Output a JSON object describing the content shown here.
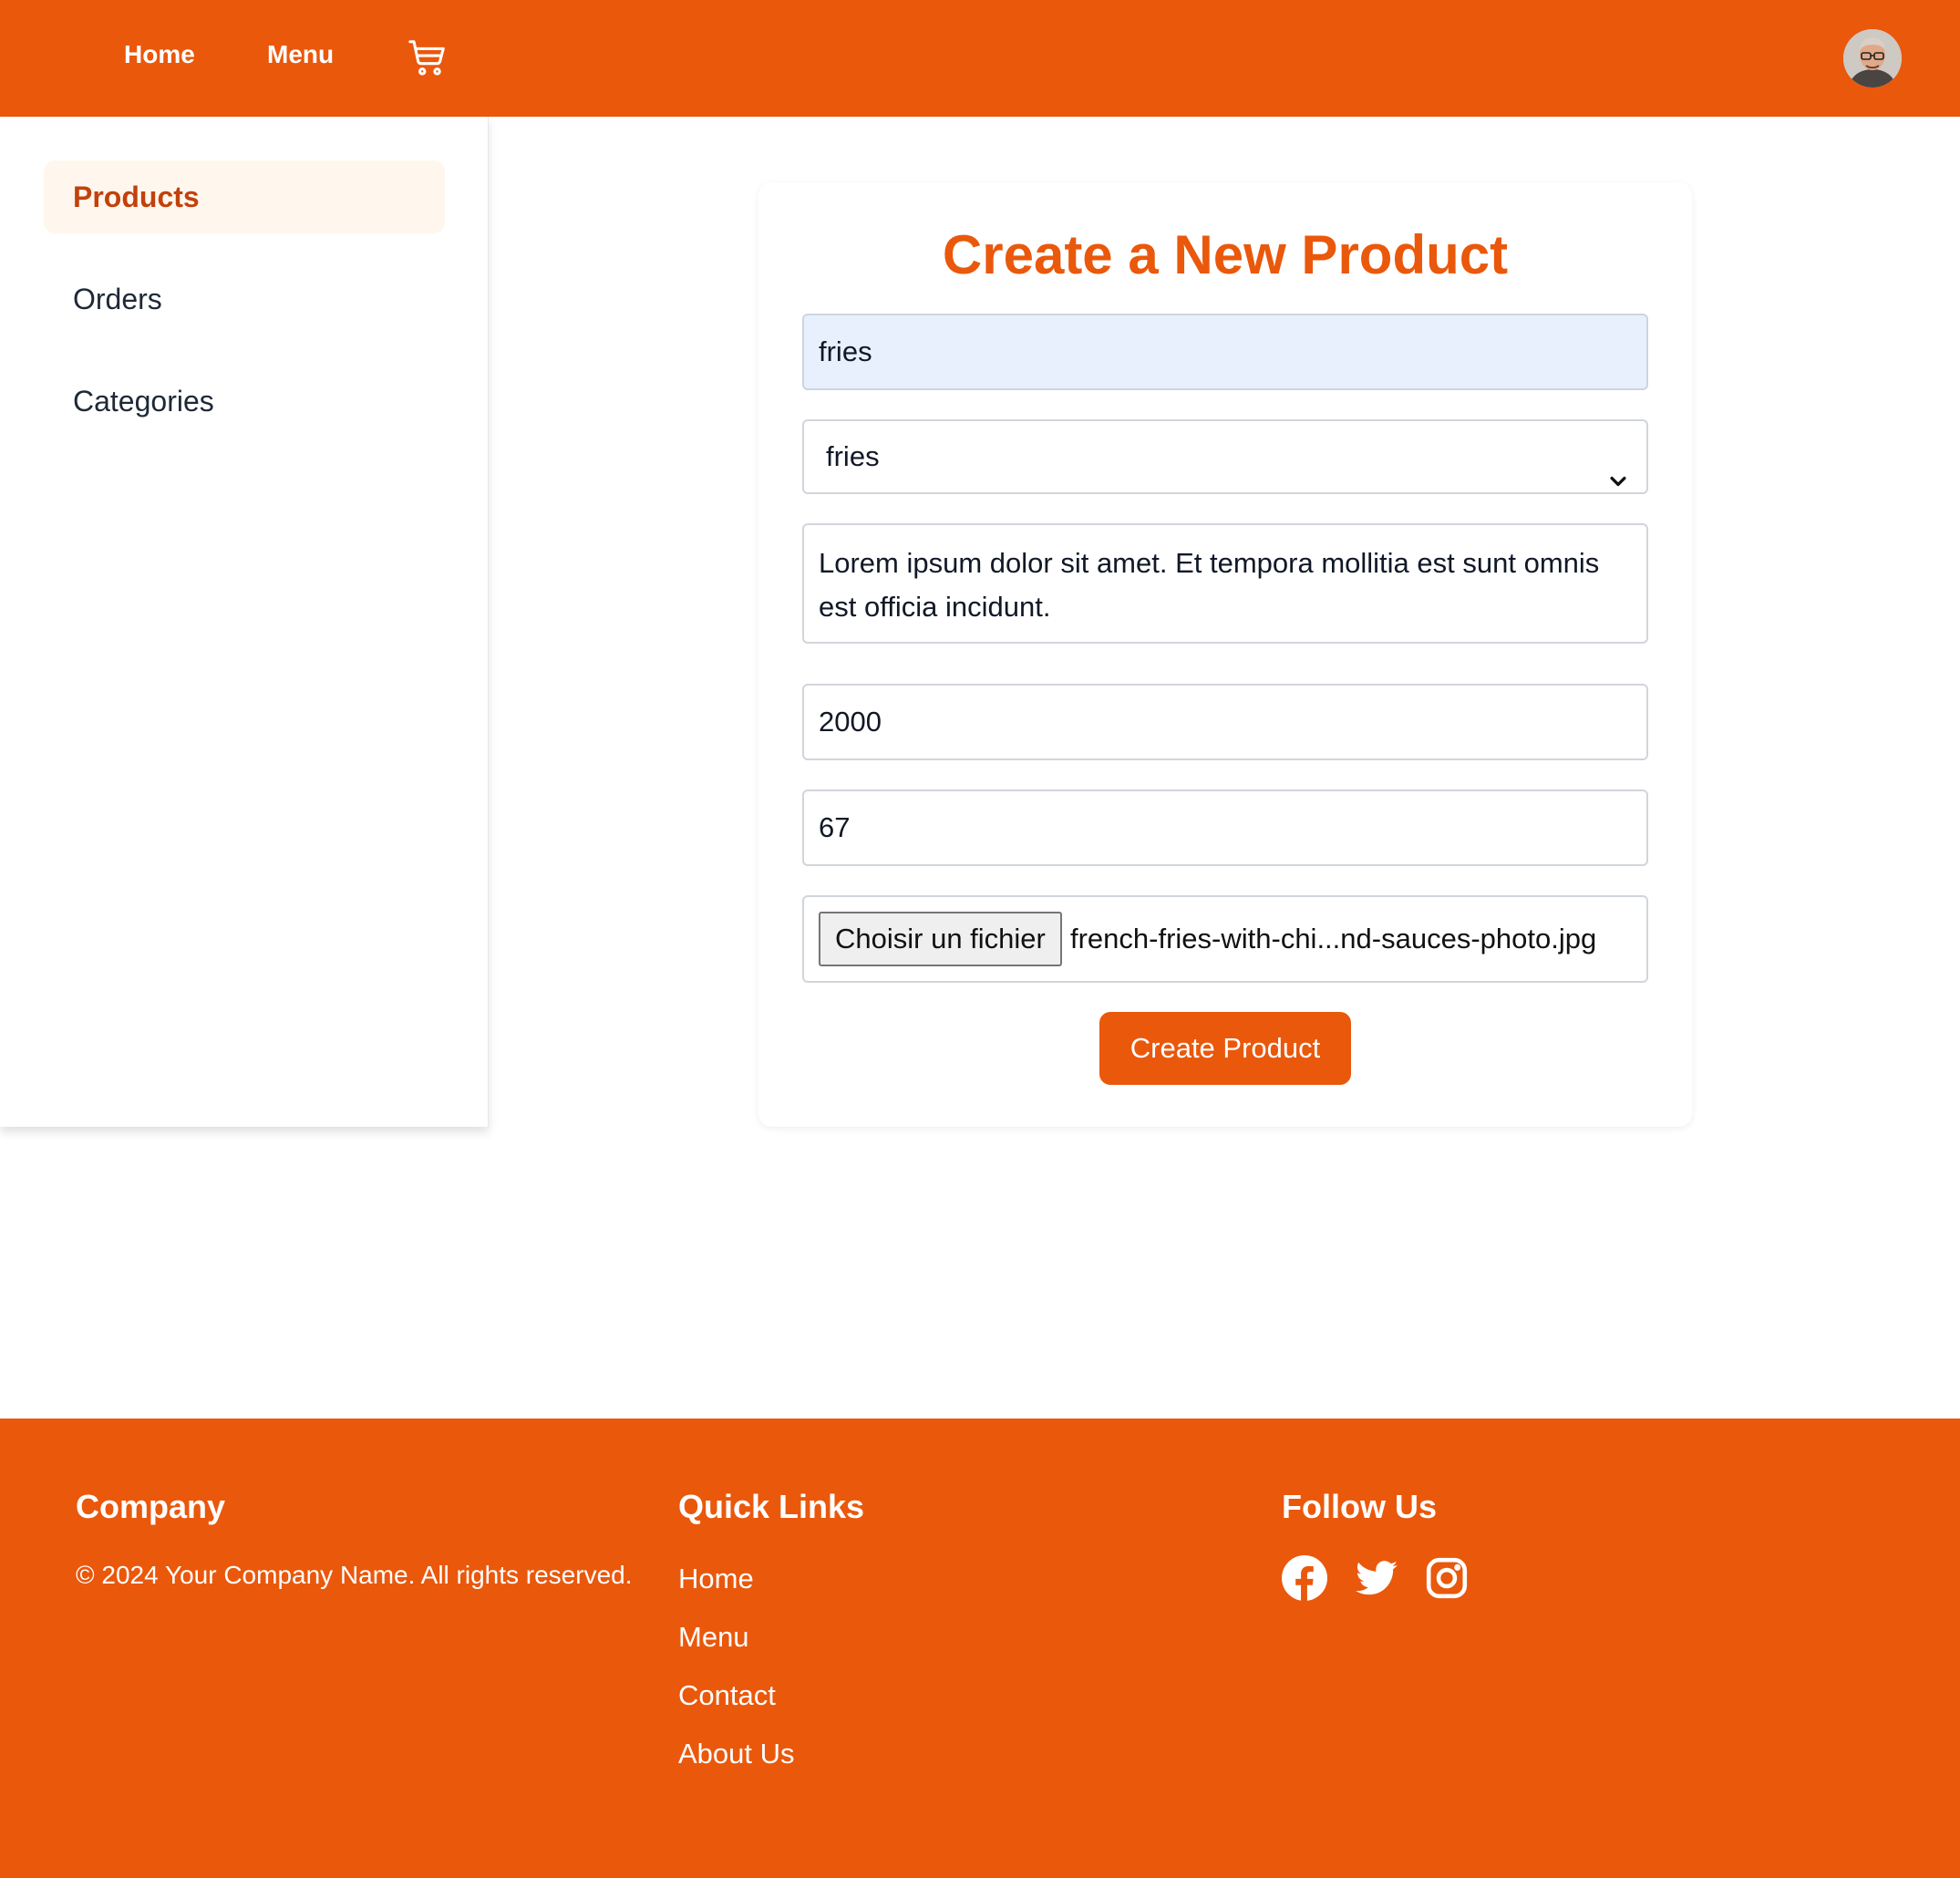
{
  "header": {
    "nav": {
      "home": "Home",
      "menu": "Menu"
    },
    "cart_icon": "shopping-cart-icon",
    "avatar_icon": "user-avatar"
  },
  "sidebar": {
    "items": [
      {
        "label": "Products",
        "active": true
      },
      {
        "label": "Orders",
        "active": false
      },
      {
        "label": "Categories",
        "active": false
      }
    ]
  },
  "form": {
    "title": "Create a New Product",
    "name_value": "fries",
    "category_selected": "fries",
    "description_value": "Lorem ipsum dolor sit amet. Et tempora mollitia est sunt omnis est officia incidunt.",
    "price_value": "2000",
    "quantity_value": "67",
    "file_button_label": "Choisir un fichier",
    "file_name": "french-fries-with-chi...nd-sauces-photo.jpg",
    "submit_label": "Create Product"
  },
  "footer": {
    "company_heading": "Company",
    "copyright": "© 2024 Your Company Name. All rights reserved.",
    "links_heading": "Quick Links",
    "links": [
      "Home",
      "Menu",
      "Contact",
      "About Us"
    ],
    "follow_heading": "Follow Us",
    "social_icons": [
      "facebook-icon",
      "twitter-icon",
      "instagram-icon"
    ]
  },
  "colors": {
    "brand": "#ea580c",
    "active_bg": "#fff7ed",
    "active_text": "#c2410c",
    "autofill_bg": "#e8f0fe"
  }
}
